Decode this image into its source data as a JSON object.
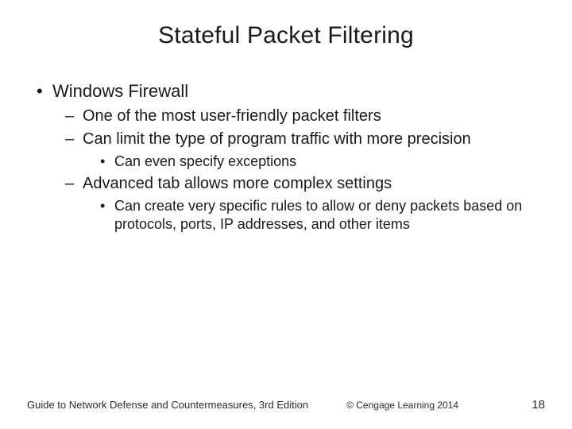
{
  "title": "Stateful Packet Filtering",
  "bullets": {
    "l1_0": "Windows Firewall",
    "l2_0": "One of the most user-friendly packet filters",
    "l2_1": "Can limit the type of program traffic with more precision",
    "l3_0": "Can even specify exceptions",
    "l2_2": "Advanced tab allows more complex settings",
    "l3_1": "Can create very specific rules to allow or deny packets based on protocols, ports, IP addresses, and other items"
  },
  "footer": {
    "source": "Guide to Network Defense and Countermeasures, 3rd Edition",
    "copyright": "© Cengage Learning  2014",
    "page": "18"
  }
}
